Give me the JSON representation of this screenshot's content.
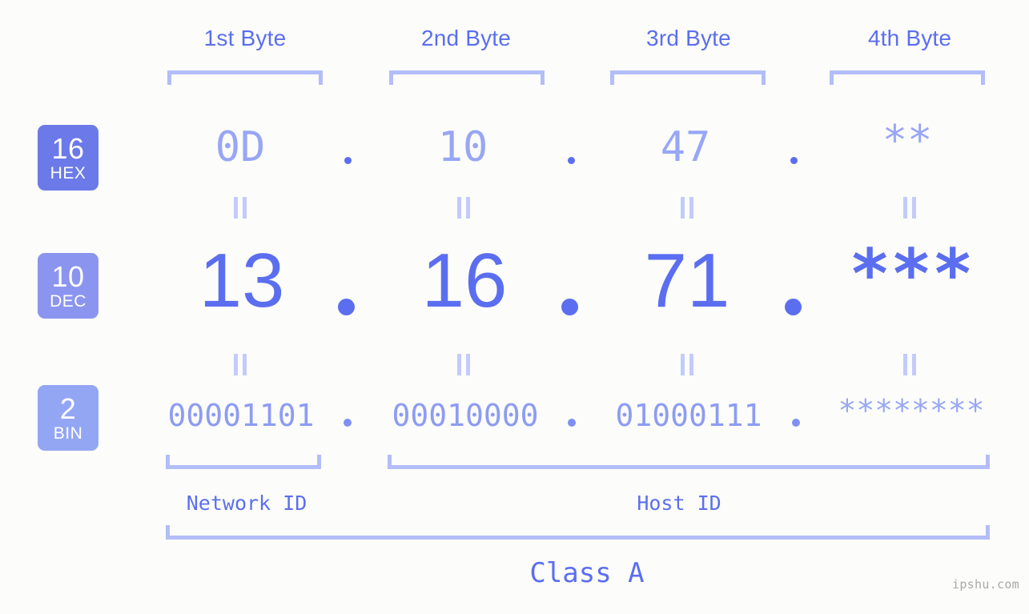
{
  "background_color": "#fcfdfa",
  "accent_color": "#5b6ef0",
  "bracket_color": "#b3bdf9",
  "byte_headers": [
    {
      "label": "1st Byte"
    },
    {
      "label": "2nd Byte"
    },
    {
      "label": "3rd Byte"
    },
    {
      "label": "4th Byte"
    }
  ],
  "rows": [
    {
      "badge_number": "16",
      "badge_name": "HEX",
      "badge_color": "#6b7ae8",
      "values": [
        "0D",
        "10",
        "47",
        "**"
      ],
      "separator": "."
    },
    {
      "badge_number": "10",
      "badge_name": "DEC",
      "badge_color": "#8b95ef",
      "values": [
        "13",
        "16",
        "71",
        "***"
      ],
      "separator": "."
    },
    {
      "badge_number": "2",
      "badge_name": "BIN",
      "badge_color": "#93a6f4",
      "values": [
        "00001101",
        "00010000",
        "01000111",
        "********"
      ],
      "separator": "."
    }
  ],
  "equality_marks": [
    {
      "name": "equals-hex-dec-1"
    },
    {
      "name": "equals-hex-dec-2"
    },
    {
      "name": "equals-hex-dec-3"
    },
    {
      "name": "equals-hex-dec-4"
    },
    {
      "name": "equals-dec-bin-1"
    },
    {
      "name": "equals-dec-bin-2"
    },
    {
      "name": "equals-dec-bin-3"
    },
    {
      "name": "equals-dec-bin-4"
    }
  ],
  "segments": {
    "network_id_label": "Network ID",
    "host_id_label": "Host ID",
    "class_label": "Class A"
  },
  "watermark": "ipshu.com"
}
